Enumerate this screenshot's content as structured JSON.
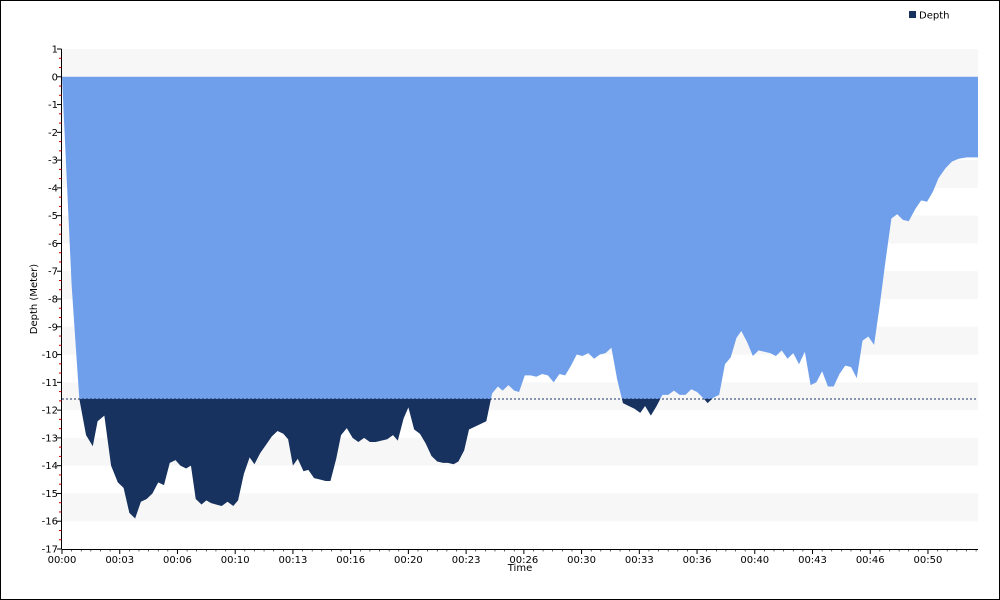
{
  "chart_data": {
    "type": "area",
    "xlabel": "Time",
    "ylabel": "Depth (Meter)",
    "x_tick_labels": [
      "00:00",
      "00:03",
      "00:06",
      "00:10",
      "00:13",
      "00:16",
      "00:20",
      "00:23",
      "00:26",
      "00:30",
      "00:33",
      "00:36",
      "00:40",
      "00:43",
      "00:46",
      "00:50"
    ],
    "x_tick_minutes": [
      0,
      3,
      6,
      9,
      12,
      15,
      18,
      21,
      24,
      27,
      30,
      33,
      36,
      39,
      42,
      45
    ],
    "x_range_minutes": [
      0,
      47.6
    ],
    "y_tick_labels": [
      "1",
      "0",
      "-1",
      "-2",
      "-3",
      "-4",
      "-5",
      "-6",
      "-7",
      "-8",
      "-9",
      "-10",
      "-11",
      "-12",
      "-13",
      "-14",
      "-15",
      "-16",
      "-17"
    ],
    "ylim": [
      -17,
      1
    ],
    "grid": "horizontal bands",
    "legend_position": "top-right",
    "threshold_depth": -11.6,
    "colors": {
      "fill_above_threshold": "#6f9feb",
      "fill_below_threshold": "#17325f",
      "threshold_line": "#17325f",
      "band": "#f7f7f7",
      "axis": "#000000",
      "minor_tick": "#cc0000"
    },
    "series": [
      {
        "name": "Depth",
        "values": [
          [
            0.0,
            0.0
          ],
          [
            0.5,
            -7.5
          ],
          [
            0.9,
            -11.6
          ],
          [
            1.25,
            -12.9
          ],
          [
            1.6,
            -13.3
          ],
          [
            1.85,
            -12.4
          ],
          [
            2.2,
            -12.2
          ],
          [
            2.55,
            -14.0
          ],
          [
            2.9,
            -14.6
          ],
          [
            3.2,
            -14.8
          ],
          [
            3.5,
            -15.7
          ],
          [
            3.8,
            -15.9
          ],
          [
            4.1,
            -15.3
          ],
          [
            4.4,
            -15.2
          ],
          [
            4.7,
            -15.0
          ],
          [
            5.0,
            -14.6
          ],
          [
            5.3,
            -14.7
          ],
          [
            5.6,
            -13.9
          ],
          [
            5.9,
            -13.8
          ],
          [
            6.15,
            -14.0
          ],
          [
            6.45,
            -14.1
          ],
          [
            6.7,
            -14.0
          ],
          [
            6.95,
            -15.2
          ],
          [
            7.25,
            -15.4
          ],
          [
            7.5,
            -15.25
          ],
          [
            7.75,
            -15.35
          ],
          [
            8.0,
            -15.4
          ],
          [
            8.3,
            -15.45
          ],
          [
            8.6,
            -15.3
          ],
          [
            8.9,
            -15.45
          ],
          [
            9.15,
            -15.25
          ],
          [
            9.45,
            -14.3
          ],
          [
            9.75,
            -13.7
          ],
          [
            10.0,
            -13.95
          ],
          [
            10.3,
            -13.55
          ],
          [
            10.6,
            -13.25
          ],
          [
            10.9,
            -12.95
          ],
          [
            11.2,
            -12.75
          ],
          [
            11.5,
            -12.85
          ],
          [
            11.75,
            -13.05
          ],
          [
            12.0,
            -14.0
          ],
          [
            12.25,
            -13.75
          ],
          [
            12.55,
            -14.2
          ],
          [
            12.8,
            -14.15
          ],
          [
            13.1,
            -14.45
          ],
          [
            13.4,
            -14.5
          ],
          [
            13.7,
            -14.55
          ],
          [
            13.95,
            -14.55
          ],
          [
            14.25,
            -13.75
          ],
          [
            14.5,
            -12.9
          ],
          [
            14.8,
            -12.65
          ],
          [
            15.1,
            -13.0
          ],
          [
            15.4,
            -13.15
          ],
          [
            15.7,
            -13.0
          ],
          [
            16.0,
            -13.15
          ],
          [
            16.3,
            -13.15
          ],
          [
            16.6,
            -13.1
          ],
          [
            16.9,
            -13.05
          ],
          [
            17.2,
            -12.9
          ],
          [
            17.45,
            -13.1
          ],
          [
            17.75,
            -12.3
          ],
          [
            18.0,
            -11.9
          ],
          [
            18.3,
            -12.7
          ],
          [
            18.6,
            -12.85
          ],
          [
            18.9,
            -13.2
          ],
          [
            19.2,
            -13.65
          ],
          [
            19.5,
            -13.85
          ],
          [
            19.8,
            -13.9
          ],
          [
            20.05,
            -13.9
          ],
          [
            20.35,
            -13.95
          ],
          [
            20.6,
            -13.85
          ],
          [
            20.9,
            -13.45
          ],
          [
            21.15,
            -12.7
          ],
          [
            21.45,
            -12.6
          ],
          [
            21.75,
            -12.5
          ],
          [
            22.05,
            -12.4
          ],
          [
            22.35,
            -11.4
          ],
          [
            22.65,
            -11.15
          ],
          [
            22.9,
            -11.3
          ],
          [
            23.2,
            -11.1
          ],
          [
            23.5,
            -11.3
          ],
          [
            23.75,
            -11.35
          ],
          [
            24.05,
            -10.75
          ],
          [
            24.35,
            -10.75
          ],
          [
            24.65,
            -10.8
          ],
          [
            24.95,
            -10.7
          ],
          [
            25.25,
            -10.75
          ],
          [
            25.55,
            -11.0
          ],
          [
            25.85,
            -10.7
          ],
          [
            26.15,
            -10.75
          ],
          [
            26.45,
            -10.4
          ],
          [
            26.75,
            -10.0
          ],
          [
            27.05,
            -10.05
          ],
          [
            27.35,
            -9.95
          ],
          [
            27.65,
            -10.15
          ],
          [
            27.95,
            -10.0
          ],
          [
            28.25,
            -9.95
          ],
          [
            28.55,
            -9.75
          ],
          [
            28.85,
            -10.9
          ],
          [
            29.15,
            -11.75
          ],
          [
            29.45,
            -11.85
          ],
          [
            29.75,
            -11.95
          ],
          [
            30.05,
            -12.1
          ],
          [
            30.3,
            -11.85
          ],
          [
            30.6,
            -12.2
          ],
          [
            30.9,
            -11.85
          ],
          [
            31.2,
            -11.45
          ],
          [
            31.5,
            -11.45
          ],
          [
            31.8,
            -11.3
          ],
          [
            32.1,
            -11.45
          ],
          [
            32.4,
            -11.45
          ],
          [
            32.7,
            -11.25
          ],
          [
            33.0,
            -11.35
          ],
          [
            33.3,
            -11.55
          ],
          [
            33.55,
            -11.75
          ],
          [
            33.85,
            -11.55
          ],
          [
            34.15,
            -11.45
          ],
          [
            34.45,
            -10.35
          ],
          [
            34.75,
            -10.1
          ],
          [
            35.05,
            -9.4
          ],
          [
            35.3,
            -9.15
          ],
          [
            35.6,
            -9.55
          ],
          [
            35.9,
            -10.05
          ],
          [
            36.2,
            -9.85
          ],
          [
            36.5,
            -9.9
          ],
          [
            36.8,
            -9.95
          ],
          [
            37.1,
            -10.05
          ],
          [
            37.4,
            -9.85
          ],
          [
            37.7,
            -10.15
          ],
          [
            38.0,
            -9.95
          ],
          [
            38.3,
            -10.35
          ],
          [
            38.6,
            -9.9
          ],
          [
            38.9,
            -11.1
          ],
          [
            39.2,
            -11.0
          ],
          [
            39.5,
            -10.6
          ],
          [
            39.8,
            -11.15
          ],
          [
            40.1,
            -11.15
          ],
          [
            40.4,
            -10.7
          ],
          [
            40.7,
            -10.4
          ],
          [
            41.0,
            -10.45
          ],
          [
            41.3,
            -10.85
          ],
          [
            41.6,
            -9.5
          ],
          [
            41.9,
            -9.35
          ],
          [
            42.2,
            -9.65
          ],
          [
            42.5,
            -8.2
          ],
          [
            42.8,
            -6.6
          ],
          [
            43.1,
            -5.1
          ],
          [
            43.4,
            -4.95
          ],
          [
            43.7,
            -5.15
          ],
          [
            44.0,
            -5.2
          ],
          [
            44.35,
            -4.75
          ],
          [
            44.65,
            -4.45
          ],
          [
            44.95,
            -4.5
          ],
          [
            45.25,
            -4.15
          ],
          [
            45.55,
            -3.65
          ],
          [
            45.9,
            -3.3
          ],
          [
            46.25,
            -3.05
          ],
          [
            46.6,
            -2.95
          ],
          [
            47.0,
            -2.9
          ],
          [
            47.6,
            -2.9
          ]
        ]
      }
    ]
  }
}
